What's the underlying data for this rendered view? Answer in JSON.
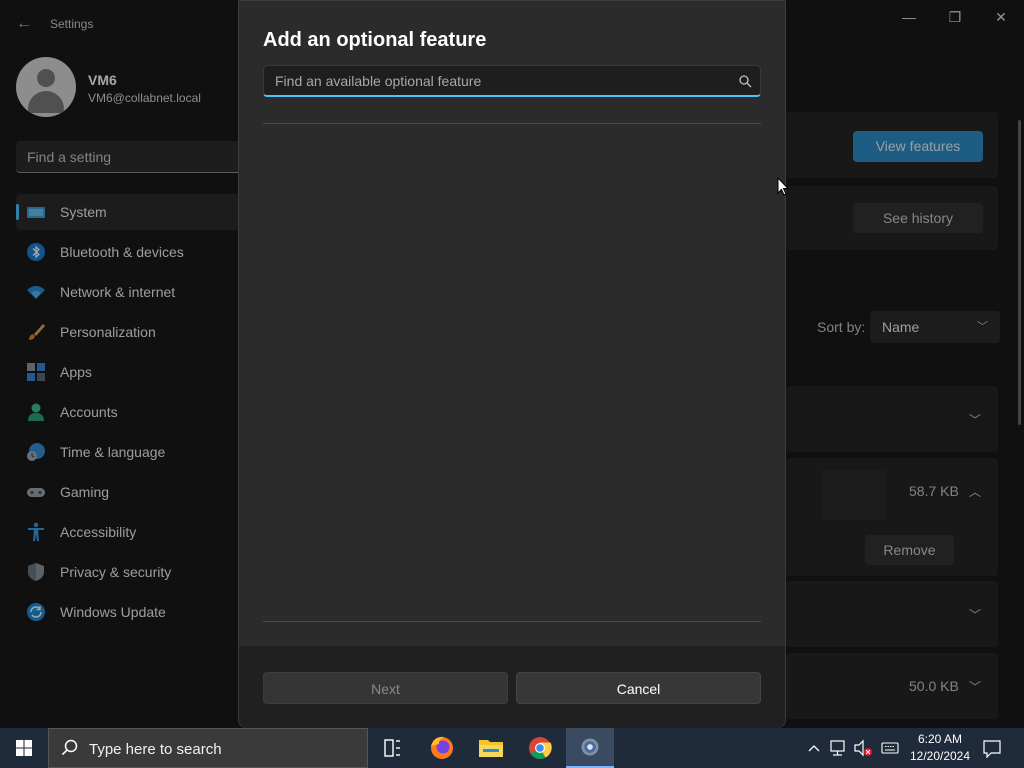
{
  "window": {
    "title": "Settings",
    "back_glyph": "←",
    "minimize_glyph": "—",
    "maximize_glyph": "❐",
    "close_glyph": "✕"
  },
  "profile": {
    "name": "VM6",
    "email": "VM6@collabnet.local"
  },
  "search": {
    "placeholder": "Find a setting"
  },
  "sidebar": {
    "items": [
      {
        "label": "System",
        "icon": "system-icon",
        "selected": true
      },
      {
        "label": "Bluetooth & devices",
        "icon": "bluetooth-icon"
      },
      {
        "label": "Network & internet",
        "icon": "wifi-icon"
      },
      {
        "label": "Personalization",
        "icon": "brush-icon"
      },
      {
        "label": "Apps",
        "icon": "apps-icon"
      },
      {
        "label": "Accounts",
        "icon": "person-icon"
      },
      {
        "label": "Time & language",
        "icon": "clock-globe-icon"
      },
      {
        "label": "Gaming",
        "icon": "controller-icon"
      },
      {
        "label": "Accessibility",
        "icon": "accessibility-icon"
      },
      {
        "label": "Privacy & security",
        "icon": "shield-icon"
      },
      {
        "label": "Windows Update",
        "icon": "update-icon"
      }
    ]
  },
  "main": {
    "view_features_label": "View features",
    "see_history_label": "See history",
    "sort_by_label": "Sort by:",
    "sort_value": "Name",
    "feature_rows": [
      {
        "size": ""
      },
      {
        "size": "58.7 KB",
        "remove_label": "Remove"
      },
      {
        "size": ""
      },
      {
        "size": "50.0 KB"
      }
    ]
  },
  "dialog": {
    "title": "Add an optional feature",
    "search_placeholder": "Find an available optional feature",
    "next_label": "Next",
    "cancel_label": "Cancel"
  },
  "taskbar": {
    "search_placeholder": "Type here to search",
    "time": "6:20 AM",
    "date": "12/20/2024",
    "apps": [
      "task-view-icon",
      "firefox-icon",
      "file-explorer-icon",
      "chrome-icon",
      "settings-icon"
    ]
  },
  "colors": {
    "accent": "#4cc2ff",
    "accent_button": "#2e90c9"
  }
}
